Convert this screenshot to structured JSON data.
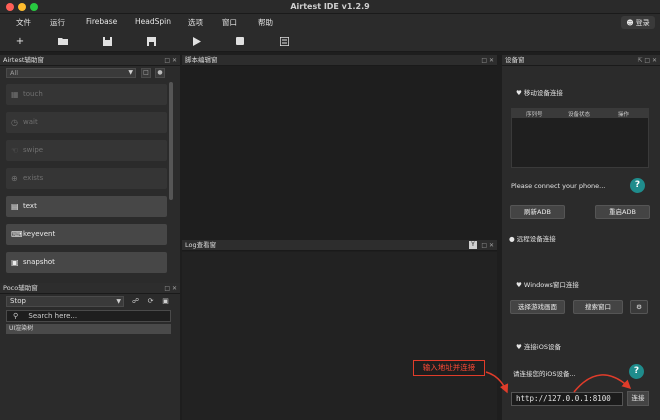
{
  "window": {
    "title": "Airtest IDE v1.2.9"
  },
  "menu": {
    "items": [
      "文件",
      "运行",
      "Firebase",
      "HeadSpin",
      "选项",
      "窗口",
      "帮助"
    ],
    "login_label": "登录"
  },
  "left": {
    "assist_title": "Airtest辅助窗",
    "filter_value": "All",
    "actions": [
      {
        "label": "touch",
        "enabled": false,
        "icon": "touch-icon"
      },
      {
        "label": "wait",
        "enabled": false,
        "icon": "wait-icon"
      },
      {
        "label": "swipe",
        "enabled": false,
        "icon": "swipe-icon"
      },
      {
        "label": "exists",
        "enabled": false,
        "icon": "exists-icon"
      },
      {
        "label": "text",
        "enabled": true,
        "icon": "text-icon"
      },
      {
        "label": "keyevent",
        "enabled": true,
        "icon": "keyboard-icon"
      },
      {
        "label": "snapshot",
        "enabled": true,
        "icon": "camera-icon"
      }
    ],
    "poco_title": "Poco辅助窗",
    "poco_mode": "Stop",
    "search_placeholder": "Search here...",
    "ui_row": "UI渲染树"
  },
  "editor": {
    "title": "脚本编辑窗"
  },
  "log": {
    "title": "Log查看窗"
  },
  "device": {
    "title": "设备窗",
    "mobile_section": "移动设备连接",
    "columns": [
      "序列号",
      "设备状态",
      "操作"
    ],
    "connect_hint": "Please connect your phone...",
    "refresh_adb": "刷新ADB",
    "restart_adb": "重启ADB",
    "remote_section": "远程设备连接",
    "windows_section": "Windows窗口连接",
    "select_game_window": "选择游戏画面",
    "search_window": "搜索窗口",
    "ios_section": "连接iOS设备",
    "ios_hint": "请连接您的iOS设备...",
    "address_value": "http://127.0.0.1:8100",
    "connect_label": "连接"
  },
  "annotation": {
    "callout": "输入地址并连接",
    "color": "#e03c2a"
  }
}
